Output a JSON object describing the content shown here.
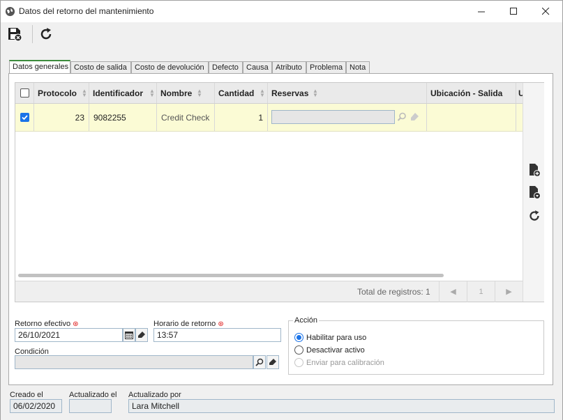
{
  "window": {
    "title": "Datos del retorno del mantenimiento"
  },
  "toolbar": {
    "save_icon": "save-close-icon",
    "refresh_icon": "refresh-icon"
  },
  "tabs": [
    {
      "label": "Datos generales",
      "active": true
    },
    {
      "label": "Costo de salida"
    },
    {
      "label": "Costo de devolución"
    },
    {
      "label": "Defecto"
    },
    {
      "label": "Causa"
    },
    {
      "label": "Atributo"
    },
    {
      "label": "Problema"
    },
    {
      "label": "Nota"
    }
  ],
  "grid": {
    "columns": [
      "Protocolo",
      "Identificador",
      "Nombre",
      "Cantidad",
      "Reservas",
      "Ubicación - Salida",
      "U"
    ],
    "rows": [
      {
        "checked": true,
        "protocolo": "23",
        "identificador": "9082255",
        "nombre": "Credit Check",
        "cantidad": "1",
        "reservas": "",
        "ubicacion": ""
      }
    ],
    "footer": {
      "total_label": "Total de registros: 1",
      "page": "1"
    }
  },
  "form": {
    "retorno_label": "Retorno efectivo",
    "retorno_value": "26/10/2021",
    "horario_label": "Horario de retorno",
    "horario_value": "13:57",
    "condicion_label": "Condición",
    "condicion_value": ""
  },
  "accion": {
    "legend": "Acción",
    "options": [
      {
        "label": "Habilitar para uso",
        "selected": true
      },
      {
        "label": "Desactivar activo",
        "selected": false
      },
      {
        "label": "Enviar para calibración",
        "selected": false,
        "disabled": true
      }
    ]
  },
  "footer": {
    "creado_label": "Creado el",
    "creado_value": "06/02/2020",
    "actualizado_label": "Actualizado el",
    "actualizado_value": "",
    "actualizado_por_label": "Actualizado por",
    "actualizado_por_value": "Lara Mitchell"
  },
  "colors": {
    "accent": "#1a73e8",
    "row_highlight": "#fbfbd5",
    "tab_active": "#3d8c3d"
  }
}
